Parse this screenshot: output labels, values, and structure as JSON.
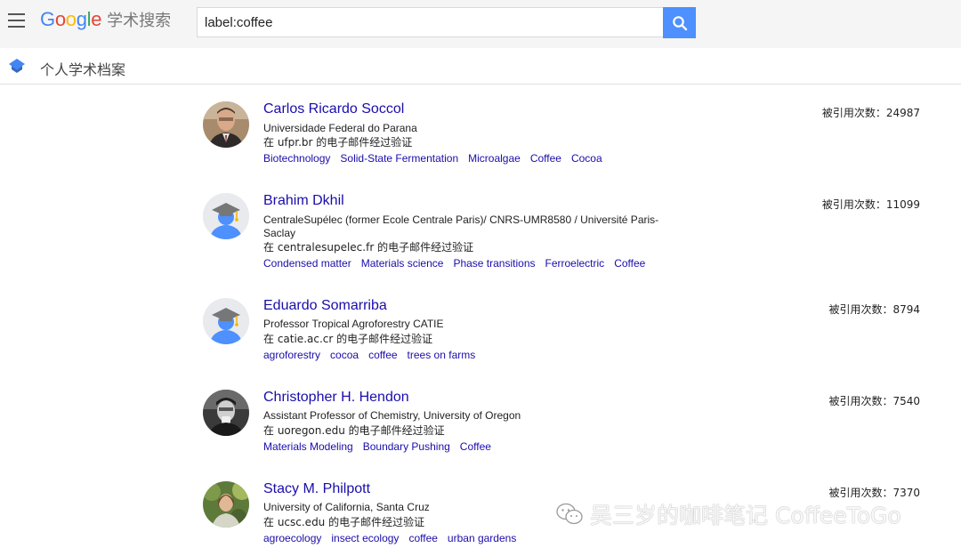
{
  "header": {
    "logo_letters": [
      {
        "ch": "G",
        "color": "#4285F4"
      },
      {
        "ch": "o",
        "color": "#EA4335"
      },
      {
        "ch": "o",
        "color": "#FBBC05"
      },
      {
        "ch": "g",
        "color": "#4285F4"
      },
      {
        "ch": "l",
        "color": "#34A853"
      },
      {
        "ch": "e",
        "color": "#EA4335"
      }
    ],
    "scholar": "学术搜索",
    "search_value": "label:coffee"
  },
  "subheader": {
    "title": "个人学术档案"
  },
  "profiles": [
    {
      "name": "Carlos Ricardo Soccol",
      "affiliation": "Universidade Federal do Parana",
      "verified": "在 ufpr.br 的电子邮件经过验证",
      "citations": "被引用次数：24987",
      "tags": [
        "Biotechnology",
        "Solid-State Fermentation",
        "Microalgae",
        "Coffee",
        "Cocoa"
      ]
    },
    {
      "name": "Brahim Dkhil",
      "affiliation": "CentraleSupélec (former Ecole Centrale Paris)/ CNRS-UMR8580 / Université Paris-Saclay",
      "verified": "在 centralesupelec.fr 的电子邮件经过验证",
      "citations": "被引用次数：11099",
      "tags": [
        "Condensed matter",
        "Materials science",
        "Phase transitions",
        "Ferroelectric",
        "Coffee"
      ]
    },
    {
      "name": "Eduardo Somarriba",
      "affiliation": "Professor Tropical Agroforestry CATIE",
      "verified": "在 catie.ac.cr 的电子邮件经过验证",
      "citations": "被引用次数：8794",
      "tags": [
        "agroforestry",
        "cocoa",
        "coffee",
        "trees on farms"
      ]
    },
    {
      "name": "Christopher H. Hendon",
      "affiliation": "Assistant Professor of Chemistry, University of Oregon",
      "verified": "在 uoregon.edu 的电子邮件经过验证",
      "citations": "被引用次数：7540",
      "tags": [
        "Materials Modeling",
        "Boundary Pushing",
        "Coffee"
      ]
    },
    {
      "name": "Stacy M. Philpott",
      "affiliation": "University of California, Santa Cruz",
      "verified": "在 ucsc.edu 的电子邮件经过验证",
      "citations": "被引用次数：7370",
      "tags": [
        "agroecology",
        "insect ecology",
        "coffee",
        "urban gardens"
      ]
    }
  ],
  "watermark": "吴三岁的咖啡笔记 CoffeeToGo",
  "colors": {
    "link": "#1a0dab",
    "search_button": "#4d90fe",
    "topbar": "#f5f5f5"
  }
}
